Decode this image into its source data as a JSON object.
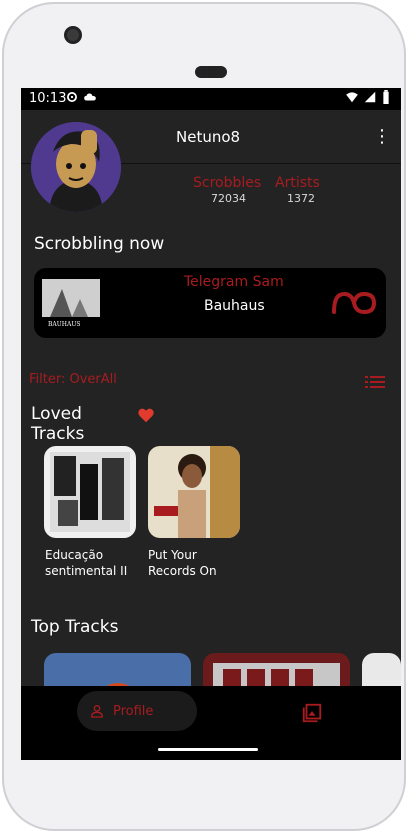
{
  "status": {
    "time": "10:13"
  },
  "profile": {
    "username": "Netuno8",
    "stats": [
      {
        "label": "Scrobbles",
        "value": "72034"
      },
      {
        "label": "Artists",
        "value": "1372"
      }
    ]
  },
  "scrobbling_now": {
    "title": "Scrobbling now",
    "artist": "Telegram Sam",
    "track": "Bauhaus",
    "album_text": "BAUHAUS"
  },
  "filter": {
    "label": "Filter: OverAll"
  },
  "loved_tracks": {
    "title": "Loved Tracks",
    "items": [
      {
        "label": "Educação sentimental II"
      },
      {
        "label": "Put Your Records On"
      }
    ]
  },
  "top_tracks": {
    "title": "Top Tracks"
  },
  "bottom_nav": {
    "profile_label": "Profile"
  },
  "colors": {
    "accent": "#a81c20",
    "background": "#232323",
    "card": "#000000"
  }
}
